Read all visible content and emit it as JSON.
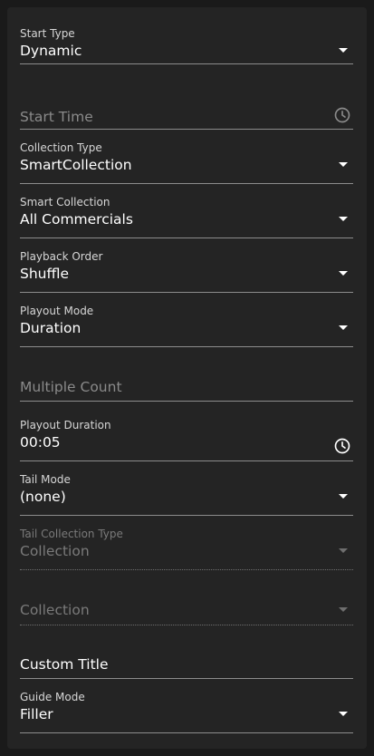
{
  "form": {
    "start_type": {
      "label": "Start Type",
      "value": "Dynamic"
    },
    "start_time": {
      "placeholder": "Start Time"
    },
    "collection_type": {
      "label": "Collection Type",
      "value": "SmartCollection"
    },
    "smart_collection": {
      "label": "Smart Collection",
      "value": "All Commercials"
    },
    "playback_order": {
      "label": "Playback Order",
      "value": "Shuffle"
    },
    "playout_mode": {
      "label": "Playout Mode",
      "value": "Duration"
    },
    "multiple_count": {
      "placeholder": "Multiple Count"
    },
    "playout_duration": {
      "label": "Playout Duration",
      "value": "00:05"
    },
    "tail_mode": {
      "label": "Tail Mode",
      "value": "(none)"
    },
    "tail_collection_type": {
      "label": "Tail Collection Type",
      "value": "Collection",
      "disabled": true
    },
    "tail_collection": {
      "placeholder": "Collection",
      "disabled": true
    },
    "custom_title": {
      "placeholder": "Custom Title"
    },
    "guide_mode": {
      "label": "Guide Mode",
      "value": "Filler"
    }
  },
  "icons": {
    "dropdown": "triangle-down-icon",
    "time": "clock-icon"
  },
  "colors": {
    "background": "#1a1a1a",
    "panel": "#242424",
    "text": "#ffffff",
    "label": "#d6d6d6",
    "placeholder": "#8a8a8a",
    "disabled": "#7a7a7a"
  }
}
